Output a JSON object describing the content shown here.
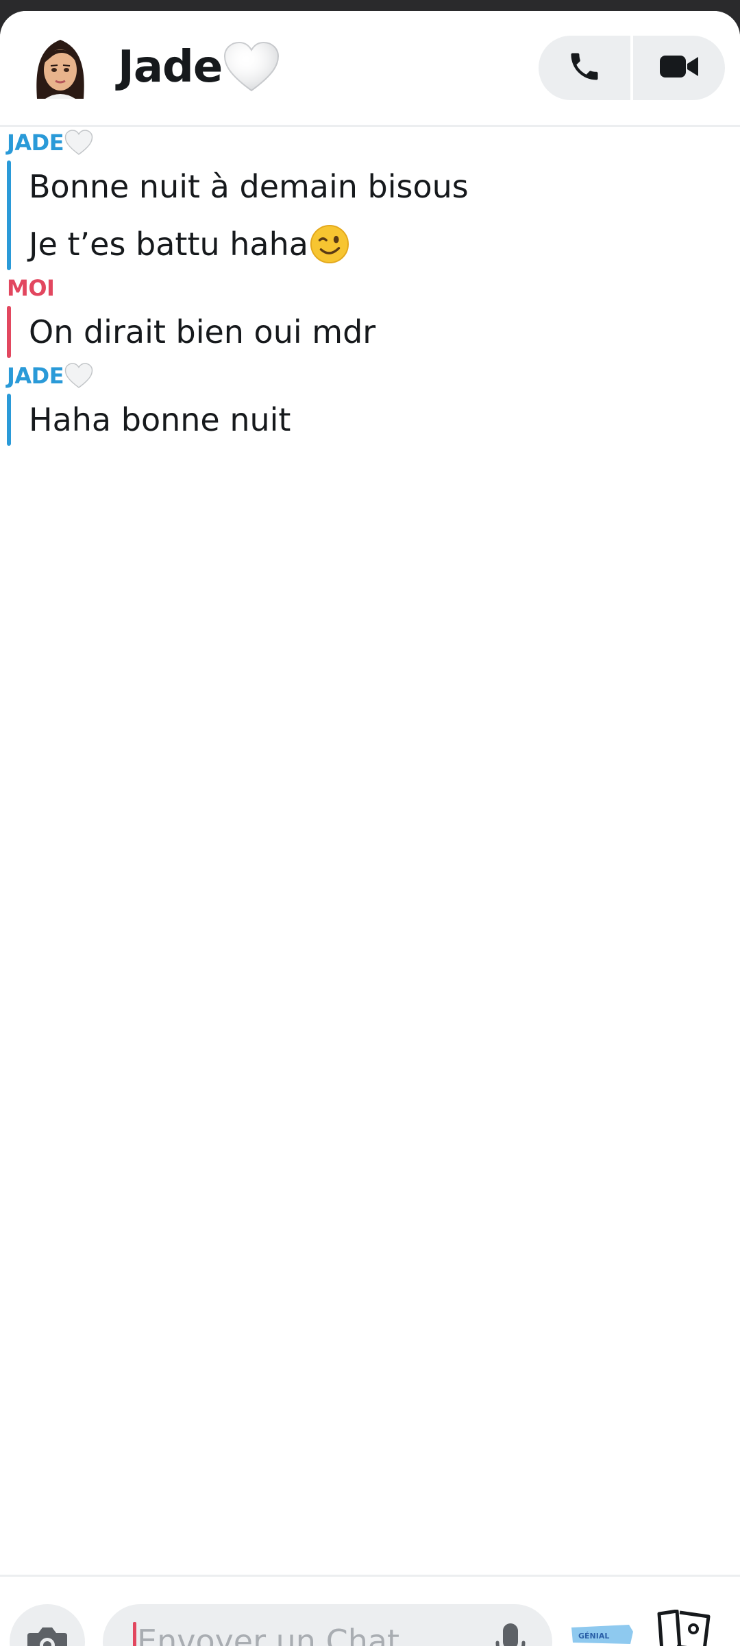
{
  "header": {
    "contact_name": "Jade",
    "avatar_icon": "bitmoji-avatar-icon",
    "heart_icon": "white-heart-icon",
    "call_icon": "phone-icon",
    "video_icon": "video-camera-icon"
  },
  "messages": [
    {
      "sender": "JADE",
      "sender_color": "#2a9ad8",
      "lines": [
        "Bonne nuit à demain bisous",
        "Je t’es battu haha"
      ],
      "emoji": "winking-face-icon"
    },
    {
      "sender": "MOI",
      "sender_color": "#e2475f",
      "lines": [
        "On dirait bien oui mdr"
      ]
    },
    {
      "sender": "JADE",
      "sender_color": "#2a9ad8",
      "lines": [
        "Haha bonne nuit"
      ]
    }
  ],
  "composer": {
    "placeholder": "Envoyer un Chat",
    "camera_icon": "camera-icon",
    "mic_icon": "microphone-icon",
    "sticker_text": "GÉNIAL",
    "cards_icon": "cards-icon"
  },
  "colors": {
    "jade": "#2a9ad8",
    "moi": "#e2475f",
    "text": "#16191c",
    "pill": "#eceef0"
  }
}
